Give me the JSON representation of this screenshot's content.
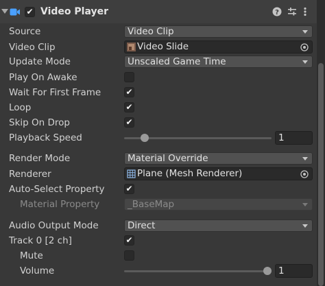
{
  "component": {
    "title": "Video Player",
    "enabled": true,
    "icons": [
      "video-player-icon",
      "help-icon",
      "preset-icon",
      "more-menu-icon"
    ]
  },
  "fields": {
    "source": {
      "label": "Source",
      "value": "Video Clip"
    },
    "video_clip": {
      "label": "Video Clip",
      "value": "Video Slide"
    },
    "update_mode": {
      "label": "Update Mode",
      "value": "Unscaled Game Time"
    },
    "play_on_awake": {
      "label": "Play On Awake",
      "checked": false
    },
    "wait_first_frame": {
      "label": "Wait For First Frame",
      "checked": true
    },
    "loop": {
      "label": "Loop",
      "checked": true
    },
    "skip_on_drop": {
      "label": "Skip On Drop",
      "checked": true
    },
    "playback_speed": {
      "label": "Playback Speed",
      "value": "1",
      "slider_fraction": 0.12
    },
    "render_mode": {
      "label": "Render Mode",
      "value": "Material Override"
    },
    "renderer": {
      "label": "Renderer",
      "value": "Plane (Mesh Renderer)"
    },
    "auto_select": {
      "label": "Auto-Select Property",
      "checked": true
    },
    "material_property": {
      "label": "Material Property",
      "value": "_BaseMap"
    },
    "audio_output_mode": {
      "label": "Audio Output Mode",
      "value": "Direct"
    },
    "track0": {
      "label": "Track 0 [2 ch]",
      "checked": true
    },
    "mute": {
      "label": "Mute",
      "checked": false
    },
    "volume": {
      "label": "Volume",
      "value": "1",
      "slider_fraction": 1.0
    }
  },
  "check_glyph": "✔",
  "colors": {
    "background": "#383838",
    "header": "#3e3e3e",
    "accent_icon": "#4aa0ff"
  }
}
